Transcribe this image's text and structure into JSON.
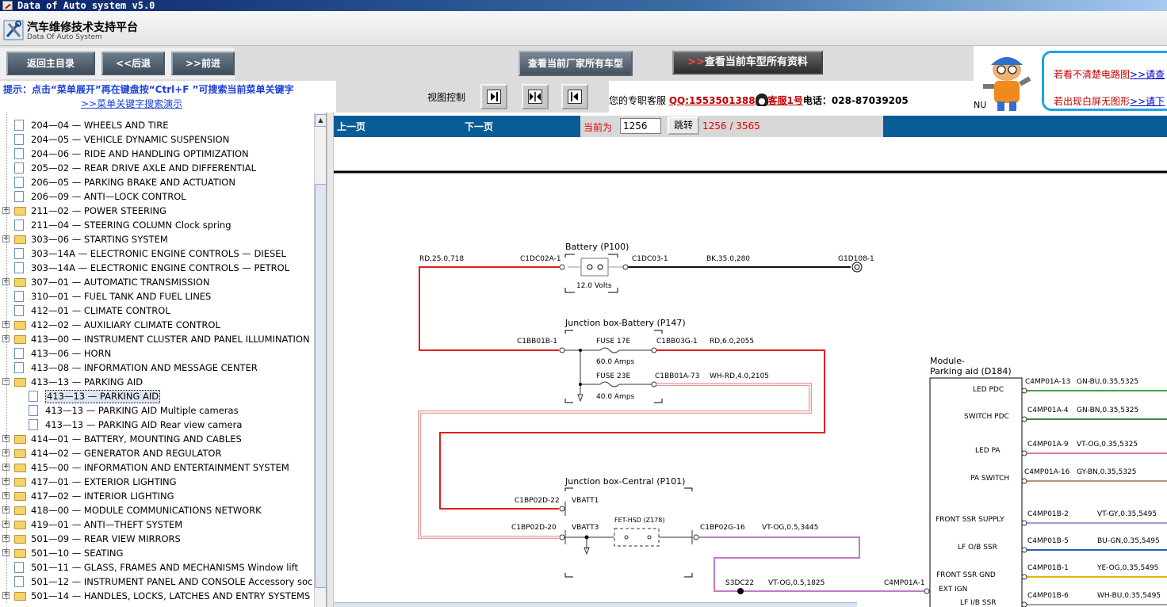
{
  "window": {
    "title": "Data of Auto system v5.0"
  },
  "header": {
    "title": "汽车维修技术支持平台",
    "subtitle": "Data Of Auto System"
  },
  "toolbar": {
    "home_label": "返回主目录",
    "back_label": "<<后退",
    "forward_label": ">>前进",
    "mfr_models_label": "查看当前厂家所有车型",
    "all_data_arrow": ">>",
    "all_data_label": "查看当前车型所有资料"
  },
  "banner": {
    "line1": "若看不清楚电路图",
    "line1_link": ">>请查",
    "line2": "若出现白屏无图形",
    "line2_link": ">>请下",
    "nu": "NU"
  },
  "hint": {
    "text": "提示：点击“菜单展开”再在键盘按“Ctrl+F ”可搜索当前菜单关键字",
    "link": ">>菜单关键字搜索演示"
  },
  "view_control": {
    "label": "视图控制"
  },
  "service": {
    "prefix": "您的专职客服",
    "qq": "QQ:1553501388",
    "kf": "客服1号",
    "phone": "电话：028-87039205"
  },
  "tree": {
    "items": [
      {
        "label": "204—04 — WHEELS AND TIRE",
        "type": "doc",
        "expandable": false
      },
      {
        "label": "204—05 — VEHICLE DYNAMIC SUSPENSION",
        "type": "doc",
        "expandable": false
      },
      {
        "label": "204—06 — RIDE AND HANDLING OPTIMIZATION",
        "type": "doc",
        "expandable": false
      },
      {
        "label": "205—02 — REAR DRIVE AXLE AND DIFFERENTIAL",
        "type": "doc",
        "expandable": false
      },
      {
        "label": "206—05 — PARKING BRAKE AND ACTUATION",
        "type": "doc",
        "expandable": false
      },
      {
        "label": "206—09 — ANTI—LOCK CONTROL",
        "type": "doc",
        "expandable": false
      },
      {
        "label": "211—02 — POWER STEERING",
        "type": "folder",
        "expandable": true
      },
      {
        "label": "211—04 — STEERING COLUMN Clock spring",
        "type": "doc",
        "expandable": false
      },
      {
        "label": "303—06 — STARTING SYSTEM",
        "type": "folder",
        "expandable": true
      },
      {
        "label": "303—14A — ELECTRONIC ENGINE CONTROLS — DIESEL",
        "type": "doc",
        "expandable": false
      },
      {
        "label": "303—14A — ELECTRONIC ENGINE CONTROLS — PETROL",
        "type": "doc",
        "expandable": false
      },
      {
        "label": "307—01 — AUTOMATIC TRANSMISSION",
        "type": "folder",
        "expandable": true
      },
      {
        "label": "310—01 — FUEL TANK AND FUEL LINES",
        "type": "doc",
        "expandable": false
      },
      {
        "label": "412—01 — CLIMATE CONTROL",
        "type": "doc",
        "expandable": false
      },
      {
        "label": "412—02 — AUXILIARY CLIMATE CONTROL",
        "type": "folder",
        "expandable": true
      },
      {
        "label": "413—00 — INSTRUMENT CLUSTER AND PANEL ILLUMINATION",
        "type": "folder",
        "expandable": true
      },
      {
        "label": "413—06 — HORN",
        "type": "doc",
        "expandable": false
      },
      {
        "label": "413—08 — INFORMATION AND MESSAGE CENTER",
        "type": "doc",
        "expandable": false
      },
      {
        "label": "413—13 — PARKING AID",
        "type": "folder",
        "expandable": true,
        "open": true
      },
      {
        "label": "413—13 — PARKING AID",
        "type": "doc",
        "child": true,
        "selected": true
      },
      {
        "label": "413—13 — PARKING AID Multiple cameras",
        "type": "doc",
        "child": true
      },
      {
        "label": "413—13 — PARKING AID Rear view camera",
        "type": "doc",
        "child": true
      },
      {
        "label": "414—01 — BATTERY, MOUNTING AND CABLES",
        "type": "folder",
        "expandable": true
      },
      {
        "label": "414—02 — GENERATOR AND REGULATOR",
        "type": "folder",
        "expandable": true
      },
      {
        "label": "415—00 — INFORMATION AND ENTERTAINMENT SYSTEM",
        "type": "folder",
        "expandable": true
      },
      {
        "label": "417—01 — EXTERIOR LIGHTING",
        "type": "folder",
        "expandable": true
      },
      {
        "label": "417—02 — INTERIOR LIGHTING",
        "type": "folder",
        "expandable": true
      },
      {
        "label": "418—00 — MODULE COMMUNICATIONS NETWORK",
        "type": "folder",
        "expandable": true
      },
      {
        "label": "419—01 — ANTI—THEFT SYSTEM",
        "type": "folder",
        "expandable": true
      },
      {
        "label": "501—09 — REAR VIEW MIRRORS",
        "type": "folder",
        "expandable": true
      },
      {
        "label": "501—10 — SEATING",
        "type": "folder",
        "expandable": true
      },
      {
        "label": "501—11 — GLASS, FRAMES AND MECHANISMS Window lift",
        "type": "doc",
        "expandable": false
      },
      {
        "label": "501—12 — INSTRUMENT PANEL AND CONSOLE Accessory soc",
        "type": "doc",
        "expandable": false
      },
      {
        "label": "501—14 — HANDLES, LOCKS, LATCHES AND ENTRY SYSTEMS",
        "type": "folder",
        "expandable": true
      }
    ]
  },
  "pager": {
    "prev_label": "上一页",
    "next_label": "下一页",
    "current_label": "当前为",
    "current_value": "1256",
    "go_label": "跳转",
    "count_text": "1256 / 3565"
  },
  "diagram": {
    "labels": {
      "battery_title": "Battery (P100)",
      "rd_wire": "RD,25.0,718",
      "c1dc02a": "C1DC02A-1",
      "c1dc03": "C1DC03-1",
      "bk_wire": "BK,35.0,280",
      "g1d108": "G1D108-1",
      "volts": "12.0 Volts",
      "jb_battery_title": "Junction box-Battery (P147)",
      "c1bb01b": "C1BB01B-1",
      "fuse17": "FUSE 17E",
      "amps60": "60.0 Amps",
      "c1bb03g": "C1BB03G-1",
      "rd6": "RD,6.0,2055",
      "fuse23": "FUSE 23E",
      "c1bb01a": "C1BB01A-73",
      "whrd": "WH-RD,4.0,2105",
      "amps40": "40.0 Amps",
      "jb_central_title": "Junction box-Central (P101)",
      "c1bp02d22": "C1BP02D-22",
      "vbatt1": "VBATT1",
      "c1bp02d20": "C1BP02D-20",
      "vbatt3": "VBATT3",
      "fet": "FET-HSD (Z178)",
      "c1bp02g16": "C1BP02G-16",
      "vtog3445": "VT-OG,0.5,3445",
      "s3dc22": "S3DC22",
      "vtog1825": "VT-OG,0.5,1825",
      "c4mp01a1": "C4MP01A-1",
      "module_title1": "Module-",
      "module_title2": "Parking aid (D184)",
      "led_pdc": "LED PDC",
      "switch_pdc": "SWITCH PDC",
      "led_pa": "LED PA",
      "pa_switch": "PA SWITCH",
      "front_ssr_supply": "FRONT SSR SUPPLY",
      "lf_ob_ssr": "LF O/B SSR",
      "front_ssr_gnd": "FRONT SSR GND",
      "ext_ign": "EXT IGN",
      "lf_ib_ssr": "LF I/B SSR",
      "p13": "C4MP01A-13",
      "w13": "GN-BU,0.35,5325",
      "p4": "C4MP01A-4",
      "w4": "GN-BN,0.35,5325",
      "p9": "C4MP01A-9",
      "w9": "VT-OG,0.35,5325",
      "p16": "C4MP01A-16",
      "w16": "GY-BN,0.35,5325",
      "pb2": "C4MP01B-2",
      "wb2": "VT-GY,0.35,5495",
      "pb5": "C4MP01B-5",
      "wb5": "BU-GN,0.35,5495",
      "pb1": "C4MP01B-1",
      "wb1": "YE-OG,0.35,5495",
      "pb6": "C4MP01B-6",
      "wb6": "WH-BU,0.35,5495"
    },
    "colors": {
      "red": "#e02020",
      "black": "#111111",
      "pink_double": "#e79a9a",
      "violet": "#c07ac7",
      "green": "#3aa63a",
      "blue": "#2d58c8",
      "yellow": "#e8b800",
      "grey": "#a0a0a0"
    }
  }
}
